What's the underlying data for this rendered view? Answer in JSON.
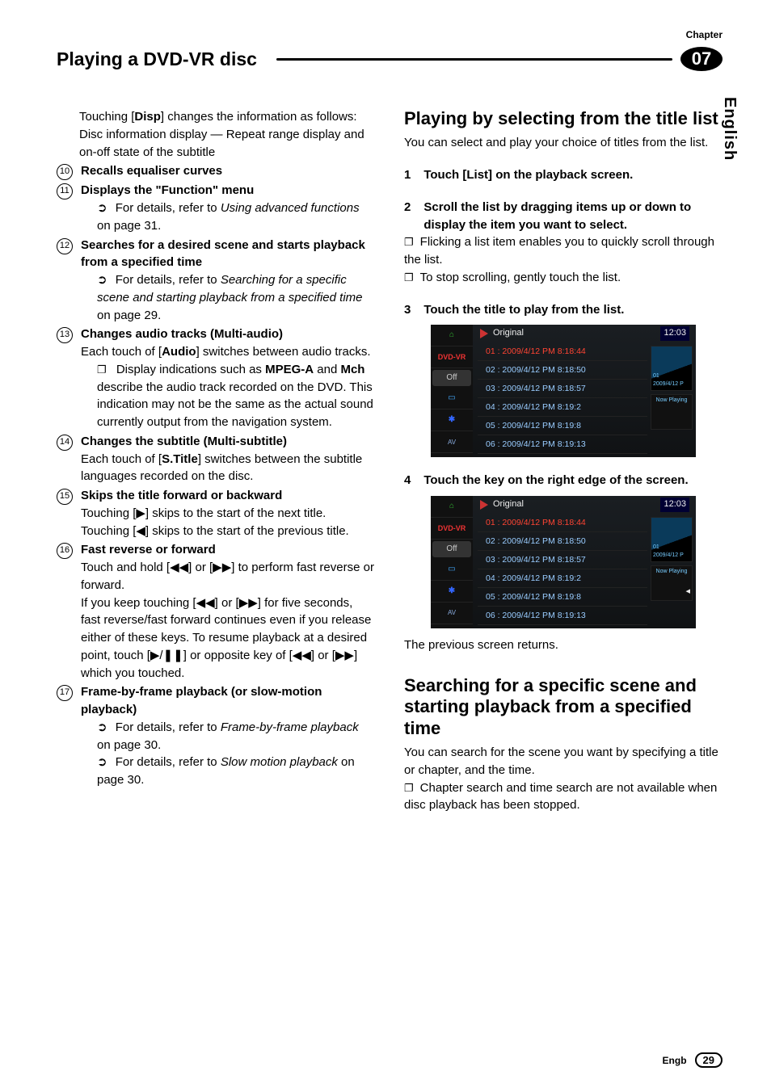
{
  "chapter_label": "Chapter",
  "chapter_number": "07",
  "section_title": "Playing a DVD-VR disc",
  "side_tab": "English",
  "left": {
    "intro1": "Touching [",
    "intro1b": "Disp",
    "intro1c": "] changes the information as follows:",
    "intro2": "Disc information display — Repeat range display and on-off state of the subtitle",
    "items": [
      {
        "n": "⑩",
        "title": "Recalls equaliser curves"
      },
      {
        "n": "⑪",
        "title": "Displays the \"Function\" menu",
        "arrow": "For details, refer to ",
        "arrow_i": "Using advanced functions",
        "arrow_tail": " on page 31."
      },
      {
        "n": "⑫",
        "title": "Searches for a desired scene and starts playback from a specified time",
        "arrow": "For details, refer to ",
        "arrow_i": "Searching for a specific scene and starting playback from a specified time",
        "arrow_tail": " on page 29."
      },
      {
        "n": "⑬",
        "title": "Changes audio tracks (Multi-audio)",
        "body_pre": "Each touch of [",
        "body_b": "Audio",
        "body_post": "] switches between audio tracks.",
        "box_pre": "Display indications such as ",
        "box_b1": "MPEG-A",
        "box_mid": " and ",
        "box_b2": "Mch",
        "box_post": " describe the audio track recorded on the DVD. This indication may not be the same as the actual sound currently output from the navigation system."
      },
      {
        "n": "⑭",
        "title": "Changes the subtitle (Multi-subtitle)",
        "body_pre": "Each touch of [",
        "body_b": "S.Title",
        "body_post": "] switches between the subtitle languages recorded on the disc."
      },
      {
        "n": "⑮",
        "title": "Skips the title forward or backward",
        "plain": "Touching [▶] skips to the start of the next title. Touching [◀] skips to the start of the previous title."
      },
      {
        "n": "⑯",
        "title": "Fast reverse or forward",
        "plain": "Touch and hold [◀◀] or [▶▶] to perform fast reverse or forward.",
        "plain2": "If you keep touching [◀◀] or [▶▶] for five seconds, fast reverse/fast forward continues even if you release either of these keys. To resume playback at a desired point, touch [▶/❚❚] or opposite key of [◀◀] or [▶▶] which you touched."
      },
      {
        "n": "⑰",
        "title": "Frame-by-frame playback (or slow-motion playback)",
        "arrow": "For details, refer to ",
        "arrow_i": "Frame-by-frame playback",
        "arrow_tail": " on page 30.",
        "arrow2": "For details, refer to ",
        "arrow2_i": "Slow motion playback",
        "arrow2_tail": " on page 30."
      }
    ]
  },
  "right": {
    "h2a": "Playing by selecting from the title list",
    "p1": "You can select and play your choice of titles from the list.",
    "steps_a": [
      {
        "n": "1",
        "t": "Touch [List] on the playback screen."
      },
      {
        "n": "2",
        "t": "Scroll the list by dragging items up or down to display the item you want to select.",
        "boxes": [
          "Flicking a list item enables you to quickly scroll through the list.",
          "To stop scrolling, gently touch the list."
        ]
      },
      {
        "n": "3",
        "t": "Touch the title to play from the list."
      },
      {
        "n": "4",
        "t": "Touch the key on the right edge of the screen."
      }
    ],
    "ss_header": "Original",
    "ss_time": "12:03",
    "sidebar_label": "DVD-VR",
    "off_label": "Off",
    "thumb_l1": "01",
    "thumb_l2": "2009/4/12 P",
    "nowplay_label": "Now Playing",
    "list_rows": [
      "01 : 2009/4/12 PM 8:18:44",
      "02 : 2009/4/12 PM 8:18:50",
      "03 : 2009/4/12 PM 8:18:57",
      "04 : 2009/4/12 PM 8:19:2",
      "05 : 2009/4/12 PM 8:19:8",
      "06 : 2009/4/12 PM 8:19:13"
    ],
    "after_ss": "The previous screen returns.",
    "h2b": "Searching for a specific scene and starting playback from a specified time",
    "p2": "You can search for the scene you want by specifying a title or chapter, and the time.",
    "box_b": "Chapter search and time search are not available when disc playback has been stopped."
  },
  "footer": {
    "engb": "Engb",
    "page": "29"
  }
}
